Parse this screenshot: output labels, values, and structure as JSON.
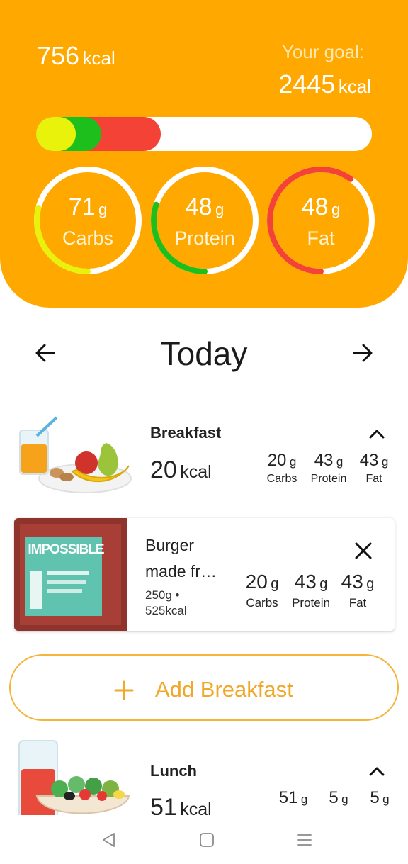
{
  "summary": {
    "current_kcal": "756",
    "current_unit": "kcal",
    "goal_label": "Your goal:",
    "goal_kcal": "2445",
    "goal_unit": "kcal",
    "colors": {
      "accent": "#FFA800",
      "carbs": "#E8F20A",
      "protein": "#1DBF1D",
      "fat": "#F44336"
    },
    "bar_fractions": {
      "carbs": 0.0,
      "protein": 0.16,
      "fat": 0.37
    }
  },
  "rings": [
    {
      "value": "71",
      "unit": "g",
      "label": "Carbs",
      "progress": 0.29,
      "color": "#E8F20A"
    },
    {
      "value": "48",
      "unit": "g",
      "label": "Protein",
      "progress": 0.3,
      "color": "#1DBF1D"
    },
    {
      "value": "48",
      "unit": "g",
      "label": "Fat",
      "progress": 0.6,
      "color": "#F44336"
    }
  ],
  "day_nav": {
    "title": "Today",
    "prev_icon": "arrow-left-icon",
    "next_icon": "arrow-right-icon"
  },
  "meals": {
    "breakfast": {
      "title": "Breakfast",
      "kcal": "20",
      "kcal_unit": "kcal",
      "collapse_icon": "chevron-up-icon",
      "macros": [
        {
          "value": "20",
          "unit": "g",
          "label": "Carbs"
        },
        {
          "value": "43",
          "unit": "g",
          "label": "Protein"
        },
        {
          "value": "43",
          "unit": "g",
          "label": "Fat"
        }
      ],
      "items": [
        {
          "name_line1": "Burger",
          "name_line2": "made fr…",
          "photo_text": "IMPOSSIBLE",
          "weight": "250g •",
          "kcal": "525kcal",
          "remove_icon": "close-icon",
          "macros": [
            {
              "value": "20",
              "unit": "g",
              "label": "Carbs"
            },
            {
              "value": "43",
              "unit": "g",
              "label": "Protein"
            },
            {
              "value": "43",
              "unit": "g",
              "label": "Fat"
            }
          ]
        }
      ],
      "add_label": "Add Breakfast"
    },
    "lunch": {
      "title": "Lunch",
      "kcal": "51",
      "kcal_unit": "kcal",
      "collapse_icon": "chevron-up-icon",
      "macros": [
        {
          "value": "51",
          "unit": "g"
        },
        {
          "value": "5",
          "unit": "g"
        },
        {
          "value": "5",
          "unit": "g"
        }
      ]
    }
  },
  "system_nav": {
    "back": "back-icon",
    "home": "home-icon",
    "menu": "menu-icon"
  }
}
